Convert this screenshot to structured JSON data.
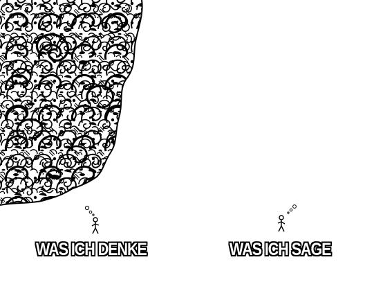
{
  "meme": {
    "left": {
      "caption": "WAS ICH DENKE"
    },
    "right": {
      "caption": "WAS ICH SAGE"
    }
  },
  "colors": {
    "background": "#ffffff",
    "ink": "#000000",
    "caption_fill": "#ffffff",
    "caption_outline": "#000000"
  },
  "icons": {
    "left_art": "dense-doodle-thought-cloud",
    "thought": "thought-bubble-dots",
    "person": "stick-figure"
  }
}
